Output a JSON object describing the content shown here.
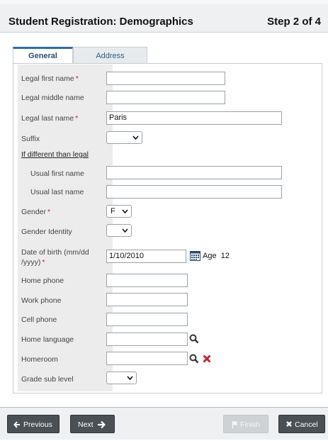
{
  "header": {
    "title": "Student Registration: Demographics",
    "step": "Step 2 of 4"
  },
  "tabs": [
    {
      "label": "General",
      "active": true
    },
    {
      "label": "Address",
      "active": false
    }
  ],
  "form": {
    "legal_first_name": {
      "label": "Legal first name",
      "required": "*",
      "value": ""
    },
    "legal_middle_name": {
      "label": "Legal middle name",
      "value": ""
    },
    "legal_last_name": {
      "label": "Legal last name",
      "required": "*",
      "value": "Paris"
    },
    "suffix": {
      "label": "Suffix",
      "value": ""
    },
    "different_link": "If different than legal",
    "usual_first_name": {
      "label": "Usual first name",
      "value": ""
    },
    "usual_last_name": {
      "label": "Usual last name",
      "value": ""
    },
    "gender": {
      "label": "Gender",
      "required": "*",
      "value": "F"
    },
    "gender_identity": {
      "label": "Gender Identity",
      "value": ""
    },
    "dob": {
      "label_line1": "Date of birth (mm/dd",
      "label_line2": "/yyyy)",
      "required": "*",
      "value": "1/10/2010",
      "age_label": "Age",
      "age_value": "12"
    },
    "home_phone": {
      "label": "Home phone",
      "value": ""
    },
    "work_phone": {
      "label": "Work phone",
      "value": ""
    },
    "cell_phone": {
      "label": "Cell phone",
      "value": ""
    },
    "home_language": {
      "label": "Home language",
      "value": ""
    },
    "homeroom": {
      "label": "Homeroom",
      "value": ""
    },
    "grade_sub_level": {
      "label": "Grade sub level",
      "value": ""
    }
  },
  "footer": {
    "previous": "Previous",
    "next": "Next",
    "finish": "Finish",
    "cancel": "Cancel"
  },
  "colors": {
    "required": "#cc2222",
    "delete_icon": "#c0282d",
    "button_dark": "#4b5054"
  },
  "icons": {
    "search": "search-icon",
    "delete": "delete-icon",
    "calendar": "calendar-icon",
    "arrow_left": "arrow-left-icon",
    "arrow_right": "arrow-right-icon",
    "flag": "flag-icon",
    "close": "close-icon"
  }
}
